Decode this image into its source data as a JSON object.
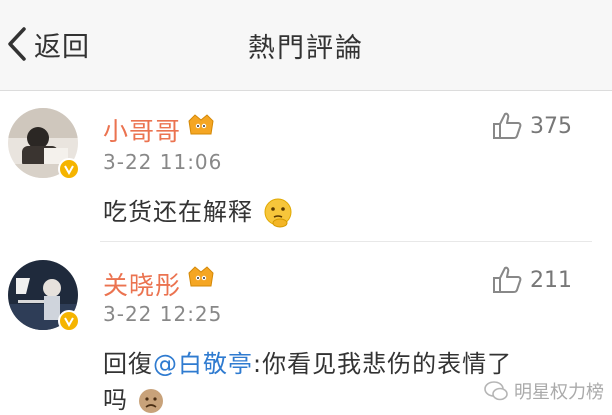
{
  "header": {
    "back_label": "返回",
    "title": "熱門評論"
  },
  "comments": [
    {
      "username": "小哥哥",
      "time": "3-22 11:06",
      "text": "吃货还在解释",
      "likes": "375",
      "emoji": "thinking-face"
    },
    {
      "username": "关晓彤",
      "time": "3-22 12:25",
      "reply_prefix": "回復",
      "mention": "@白敬亭",
      "text_after": ":你看见我悲伤的表情了",
      "text_line2": "吗",
      "likes": "211"
    }
  ],
  "watermark": {
    "text": "明星权力榜"
  },
  "colors": {
    "username": "#eb7350",
    "mention": "#2f7bd0",
    "vip_badge": "#f5b400"
  }
}
